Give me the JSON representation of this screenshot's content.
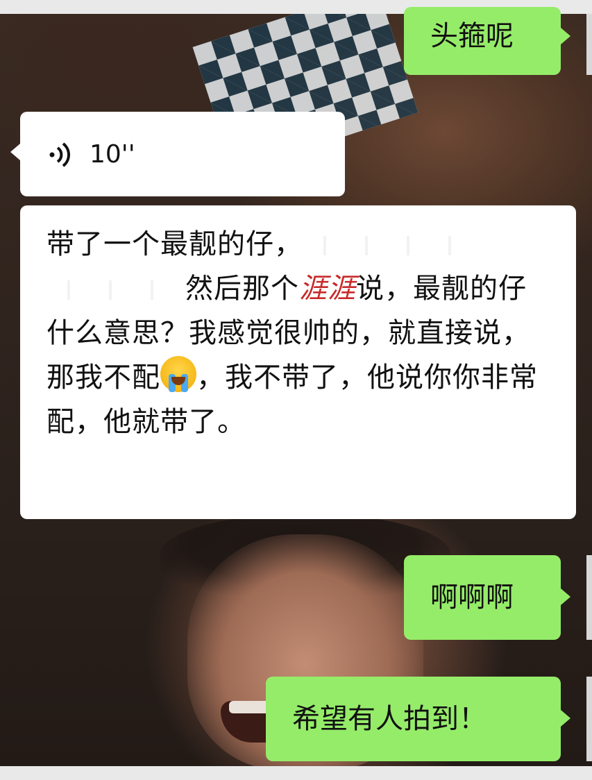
{
  "messages": [
    {
      "id": "m1",
      "direction": "outgoing",
      "text": "头箍呢"
    },
    {
      "id": "m2",
      "direction": "incoming",
      "type": "voice",
      "icon": "voice-wave-icon",
      "duration": "10''"
    },
    {
      "id": "m3",
      "direction": "incoming",
      "segments": {
        "a": "带了一个最靓的仔，",
        "b": "然后那个",
        "c": "说，最靓的仔什么意思？我感觉很帅的，就直接说，那我不配",
        "emoji": "loudly-crying-face-icon",
        "d": "，我不带了，他说你你非常配，他就带了。"
      },
      "overlay_scribble": "涯涯"
    },
    {
      "id": "m4",
      "direction": "outgoing",
      "text": "啊啊啊"
    },
    {
      "id": "m5",
      "direction": "outgoing",
      "text": "希望有人拍到！"
    }
  ],
  "colors": {
    "outgoing_bubble": "#95ec69",
    "incoming_bubble": "#ffffff",
    "scribble": "#c82a2a"
  }
}
